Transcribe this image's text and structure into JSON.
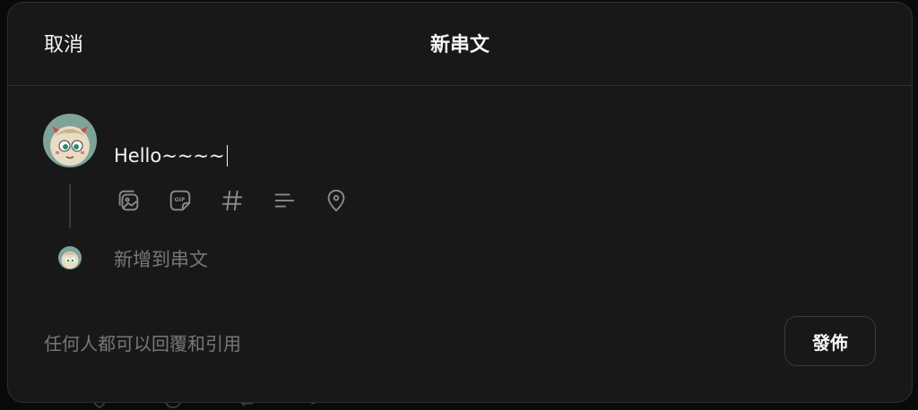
{
  "header": {
    "cancel_label": "取消",
    "title": "新串文"
  },
  "composer": {
    "post_text": "Hello~~~~",
    "tools": [
      {
        "name": "image-icon"
      },
      {
        "name": "gif-icon"
      },
      {
        "name": "hashtag-icon"
      },
      {
        "name": "poll-icon"
      },
      {
        "name": "location-icon"
      }
    ],
    "add_to_thread": "新增到串文"
  },
  "footer": {
    "reply_setting": "任何人都可以回覆和引用",
    "post_label": "發佈"
  },
  "colors": {
    "background": "#181818",
    "text_primary": "#f3f5f7",
    "text_muted": "#777777",
    "border": "#2e2e2e"
  }
}
